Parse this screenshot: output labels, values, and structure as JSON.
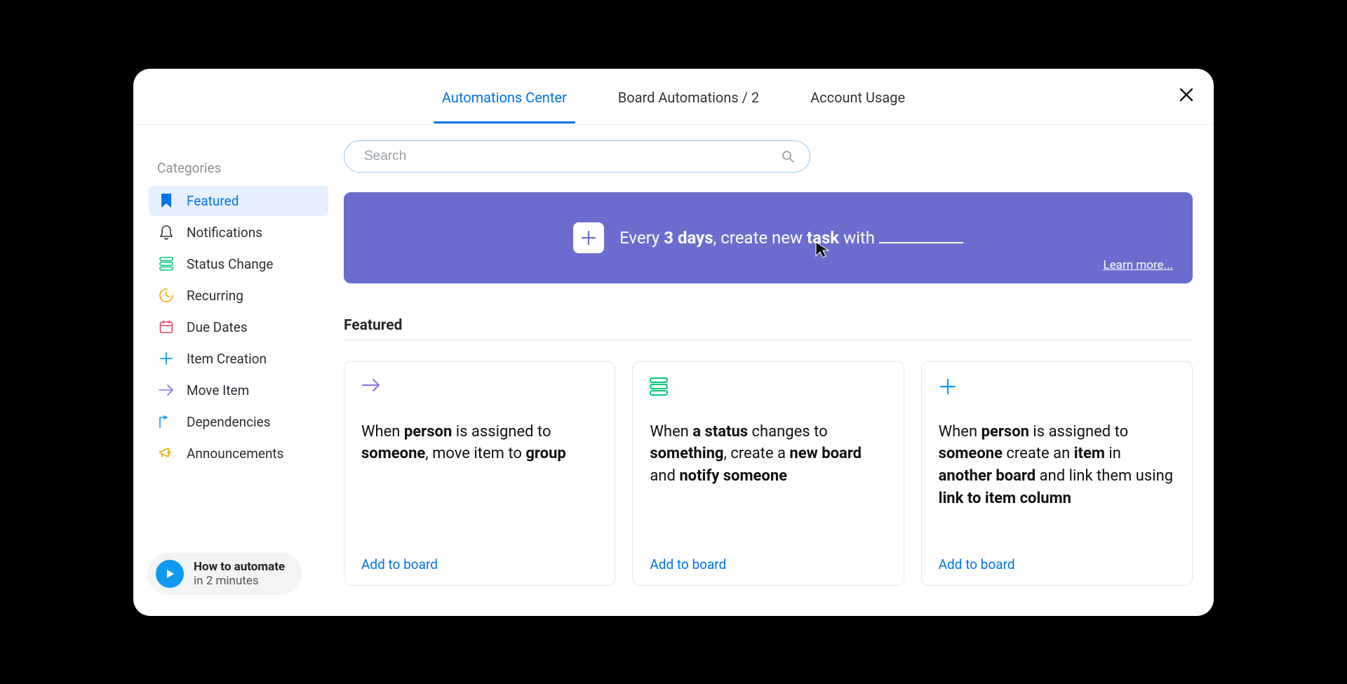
{
  "tabs": {
    "automations": "Automations Center",
    "board": "Board Automations / 2",
    "usage": "Account Usage"
  },
  "sidebar": {
    "label": "Categories",
    "items": [
      {
        "label": "Featured"
      },
      {
        "label": "Notifications"
      },
      {
        "label": "Status Change"
      },
      {
        "label": "Recurring"
      },
      {
        "label": "Due Dates"
      },
      {
        "label": "Item Creation"
      },
      {
        "label": "Move Item"
      },
      {
        "label": "Dependencies"
      },
      {
        "label": "Announcements"
      }
    ]
  },
  "help": {
    "line1": "How to automate",
    "line2": "in 2 minutes"
  },
  "search": {
    "placeholder": "Search"
  },
  "banner": {
    "prefix": "Every ",
    "days": "3 days",
    "mid": ", create new ",
    "task": "task",
    "suffix": " with ",
    "learn": "Learn more..."
  },
  "section": {
    "title": "Featured"
  },
  "cards": {
    "add": "Add to board",
    "c1": {
      "p1": "When ",
      "p2": "person",
      "p3": " is assigned to ",
      "p4": "someone",
      "p5": ", move item to ",
      "p6": "group"
    },
    "c2": {
      "p1": "When ",
      "p2": "a status",
      "p3": " changes to ",
      "p4": "something",
      "p5": ", create a ",
      "p6": "new board",
      "p7": " and ",
      "p8": "notify someone"
    },
    "c3": {
      "p1": "When ",
      "p2": "person",
      "p3": " is assigned to ",
      "p4": "someone",
      "p5": " create an ",
      "p6": "item",
      "p7": " in ",
      "p8": "another board",
      "p9": " and link them using ",
      "p10": "link to item column"
    }
  }
}
